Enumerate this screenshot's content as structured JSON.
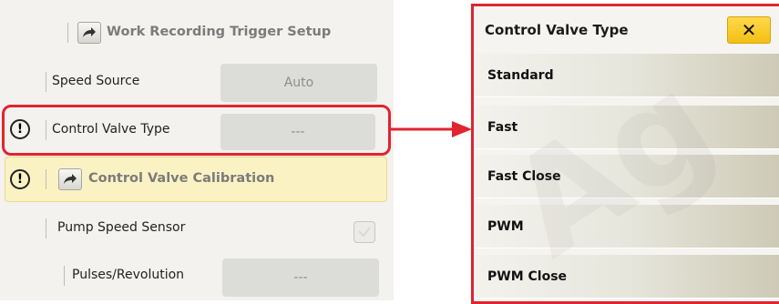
{
  "left_panel": {
    "work_recording": {
      "label": "Work Recording Trigger Setup",
      "icon": "arrow-forward-icon"
    },
    "speed_source": {
      "label": "Speed Source",
      "value": "Auto"
    },
    "control_valve_type": {
      "label": "Control Valve Type",
      "value": "---",
      "icon": "warning-icon"
    },
    "control_valve_calibration": {
      "label": "Control Valve Calibration",
      "icon": "arrow-forward-icon"
    },
    "pump_speed_sensor": {
      "label": "Pump Speed Sensor",
      "checked": false
    },
    "pulses_revolution": {
      "label": "Pulses/Revolution",
      "value": "---"
    }
  },
  "popup": {
    "title": "Control Valve Type",
    "close_icon": "close-x-icon",
    "options": [
      "Standard",
      "Fast",
      "Fast Close",
      "PWM",
      "PWM Close"
    ]
  },
  "colors": {
    "callout": "#e02430",
    "highlight": "#fbf2c4",
    "close_button": "#f7cc2c"
  }
}
